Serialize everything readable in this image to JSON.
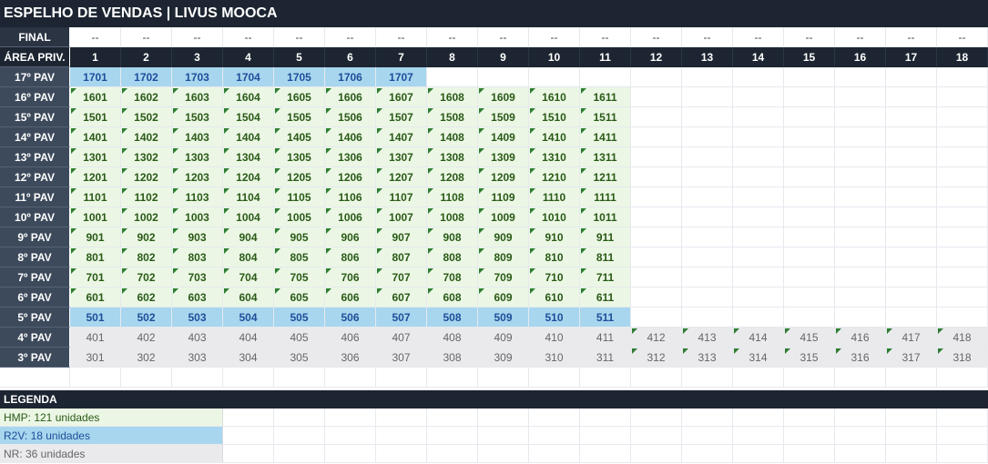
{
  "title": "ESPELHO DE VENDAS  |  LIVUS MOOCA",
  "final_label": "FINAL",
  "area_label": "ÁREA PRIV.",
  "final_values": [
    "--",
    "--",
    "--",
    "--",
    "--",
    "--",
    "--",
    "--",
    "--",
    "--",
    "--",
    "--",
    "--",
    "--",
    "--",
    "--",
    "--",
    "--"
  ],
  "columns": [
    "1",
    "2",
    "3",
    "4",
    "5",
    "6",
    "7",
    "8",
    "9",
    "10",
    "11",
    "12",
    "13",
    "14",
    "15",
    "16",
    "17",
    "18"
  ],
  "floors": [
    {
      "label": "17º PAV",
      "units": [
        "1701",
        "1702",
        "1703",
        "1704",
        "1705",
        "1706",
        "1707"
      ],
      "status": [
        "R2V",
        "R2V",
        "R2V",
        "R2V",
        "R2V",
        "R2V",
        "R2V"
      ]
    },
    {
      "label": "16º PAV",
      "units": [
        "1601",
        "1602",
        "1603",
        "1604",
        "1605",
        "1606",
        "1607",
        "1608",
        "1609",
        "1610",
        "1611"
      ],
      "status": [
        "HMP",
        "HMP",
        "HMP",
        "HMP",
        "HMP",
        "HMP",
        "HMP",
        "HMP",
        "HMP",
        "HMP",
        "HMP"
      ]
    },
    {
      "label": "15º PAV",
      "units": [
        "1501",
        "1502",
        "1503",
        "1504",
        "1505",
        "1506",
        "1507",
        "1508",
        "1509",
        "1510",
        "1511"
      ],
      "status": [
        "HMP",
        "HMP",
        "HMP",
        "HMP",
        "HMP",
        "HMP",
        "HMP",
        "HMP",
        "HMP",
        "HMP",
        "HMP"
      ]
    },
    {
      "label": "14º PAV",
      "units": [
        "1401",
        "1402",
        "1403",
        "1404",
        "1405",
        "1406",
        "1407",
        "1408",
        "1409",
        "1410",
        "1411"
      ],
      "status": [
        "HMP",
        "HMP",
        "HMP",
        "HMP",
        "HMP",
        "HMP",
        "HMP",
        "HMP",
        "HMP",
        "HMP",
        "HMP"
      ]
    },
    {
      "label": "13º PAV",
      "units": [
        "1301",
        "1302",
        "1303",
        "1304",
        "1305",
        "1306",
        "1307",
        "1308",
        "1309",
        "1310",
        "1311"
      ],
      "status": [
        "HMP",
        "HMP",
        "HMP",
        "HMP",
        "HMP",
        "HMP",
        "HMP",
        "HMP",
        "HMP",
        "HMP",
        "HMP"
      ]
    },
    {
      "label": "12º PAV",
      "units": [
        "1201",
        "1202",
        "1203",
        "1204",
        "1205",
        "1206",
        "1207",
        "1208",
        "1209",
        "1210",
        "1211"
      ],
      "status": [
        "HMP",
        "HMP",
        "HMP",
        "HMP",
        "HMP",
        "HMP",
        "HMP",
        "HMP",
        "HMP",
        "HMP",
        "HMP"
      ]
    },
    {
      "label": "11º PAV",
      "units": [
        "1101",
        "1102",
        "1103",
        "1104",
        "1105",
        "1106",
        "1107",
        "1108",
        "1109",
        "1110",
        "1111"
      ],
      "status": [
        "HMP",
        "HMP",
        "HMP",
        "HMP",
        "HMP",
        "HMP",
        "HMP",
        "HMP",
        "HMP",
        "HMP",
        "HMP"
      ]
    },
    {
      "label": "10º PAV",
      "units": [
        "1001",
        "1002",
        "1003",
        "1004",
        "1005",
        "1006",
        "1007",
        "1008",
        "1009",
        "1010",
        "1011"
      ],
      "status": [
        "HMP",
        "HMP",
        "HMP",
        "HMP",
        "HMP",
        "HMP",
        "HMP",
        "HMP",
        "HMP",
        "HMP",
        "HMP"
      ]
    },
    {
      "label": "9º PAV",
      "units": [
        "901",
        "902",
        "903",
        "904",
        "905",
        "906",
        "907",
        "908",
        "909",
        "910",
        "911"
      ],
      "status": [
        "HMP",
        "HMP",
        "HMP",
        "HMP",
        "HMP",
        "HMP",
        "HMP",
        "HMP",
        "HMP",
        "HMP",
        "HMP"
      ]
    },
    {
      "label": "8º PAV",
      "units": [
        "801",
        "802",
        "803",
        "804",
        "805",
        "806",
        "807",
        "808",
        "809",
        "810",
        "811"
      ],
      "status": [
        "HMP",
        "HMP",
        "HMP",
        "HMP",
        "HMP",
        "HMP",
        "HMP",
        "HMP",
        "HMP",
        "HMP",
        "HMP"
      ]
    },
    {
      "label": "7º PAV",
      "units": [
        "701",
        "702",
        "703",
        "704",
        "705",
        "706",
        "707",
        "708",
        "709",
        "710",
        "711"
      ],
      "status": [
        "HMP",
        "HMP",
        "HMP",
        "HMP",
        "HMP",
        "HMP",
        "HMP",
        "HMP",
        "HMP",
        "HMP",
        "HMP"
      ]
    },
    {
      "label": "6º PAV",
      "units": [
        "601",
        "602",
        "603",
        "604",
        "605",
        "606",
        "607",
        "608",
        "609",
        "610",
        "611"
      ],
      "status": [
        "HMP",
        "HMP",
        "HMP",
        "HMP",
        "HMP",
        "HMP",
        "HMP",
        "HMP",
        "HMP",
        "HMP",
        "HMP"
      ]
    },
    {
      "label": "5º PAV",
      "units": [
        "501",
        "502",
        "503",
        "504",
        "505",
        "506",
        "507",
        "508",
        "509",
        "510",
        "511"
      ],
      "status": [
        "R2V",
        "R2V",
        "R2V",
        "R2V",
        "R2V",
        "R2V",
        "R2V",
        "R2V",
        "R2V",
        "R2V",
        "R2V"
      ]
    },
    {
      "label": "4º PAV",
      "units": [
        "401",
        "402",
        "403",
        "404",
        "405",
        "406",
        "407",
        "408",
        "409",
        "410",
        "411",
        "412",
        "413",
        "414",
        "415",
        "416",
        "417",
        "418"
      ],
      "status": [
        "NR",
        "NR",
        "NR",
        "NR",
        "NR",
        "NR",
        "NR",
        "NR",
        "NR",
        "NR",
        "NR",
        "NR",
        "NR",
        "NR",
        "NR",
        "NR",
        "NR",
        "NR"
      ]
    },
    {
      "label": "3º PAV",
      "units": [
        "301",
        "302",
        "303",
        "304",
        "305",
        "306",
        "307",
        "308",
        "309",
        "310",
        "311",
        "312",
        "313",
        "314",
        "315",
        "316",
        "317",
        "318"
      ],
      "status": [
        "NR",
        "NR",
        "NR",
        "NR",
        "NR",
        "NR",
        "NR",
        "NR",
        "NR",
        "NR",
        "NR",
        "NR",
        "NR",
        "NR",
        "NR",
        "NR",
        "NR",
        "NR"
      ]
    }
  ],
  "legend": {
    "header": "LEGENDA",
    "items": [
      {
        "label": "HMP: 121 unidades",
        "status": "HMP"
      },
      {
        "label": "R2V: 18 unidades",
        "status": "R2V"
      },
      {
        "label": "NR: 36 unidades",
        "status": "NR"
      }
    ]
  },
  "colors": {
    "header_bg": "#1c2531",
    "label_bg": "#3d4a5c",
    "hmp": "#ebf7e4",
    "r2v": "#a8d6ee",
    "nr": "#eaeaed",
    "flag": "#2e7d32"
  }
}
